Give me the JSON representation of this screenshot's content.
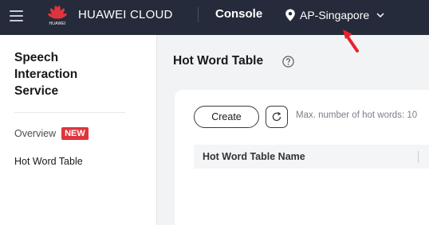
{
  "topbar": {
    "brand": "HUAWEI CLOUD",
    "logo_text": "HUAWEI",
    "console": "Console",
    "region": "AP-Singapore"
  },
  "sidebar": {
    "service_title": "Speech Interaction Service",
    "items": [
      {
        "label": "Overview",
        "badge": "NEW"
      },
      {
        "label": "Hot Word Table"
      }
    ]
  },
  "main": {
    "page_title": "Hot Word Table",
    "create_label": "Create",
    "max_info": "Max. number of hot words: 10",
    "table": {
      "columns": [
        "Hot Word Table Name"
      ]
    }
  },
  "colors": {
    "topbar_bg": "#252b3a",
    "brand_red": "#e0343c",
    "annotation_arrow": "#e8222b"
  },
  "icons": [
    "menu-icon",
    "huawei-logo-icon",
    "location-pin-icon",
    "chevron-down-icon",
    "help-icon",
    "refresh-icon",
    "red-arrow-annotation"
  ]
}
